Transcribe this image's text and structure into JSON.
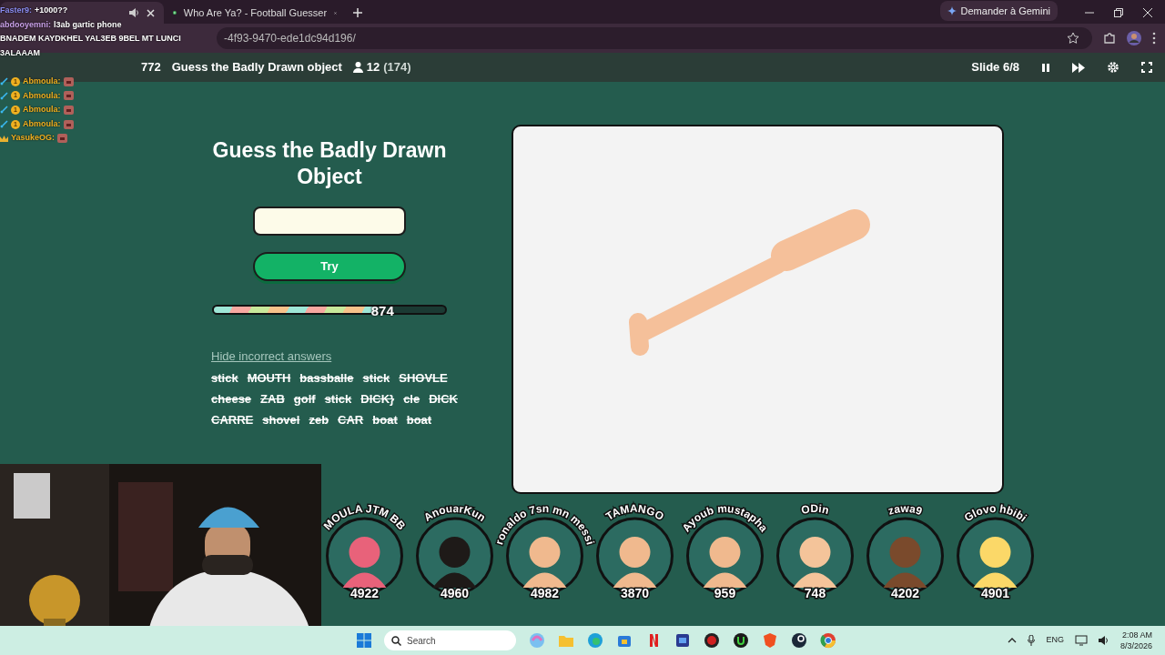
{
  "chat": [
    {
      "user": "Faster9:",
      "text": "+1000??"
    },
    {
      "user": "abdooyemni:",
      "text": "l3ab gartic phone"
    },
    {
      "text": "BNADEM KAYDKHEL YAL3EB 9BEL MT LUNCI"
    },
    {
      "text": "3ALAAAM"
    },
    {
      "badges": [
        {
          "kind": "sword"
        },
        {
          "kind": "coin",
          "label": "1"
        }
      ],
      "user": "Abmoula:",
      "emote": true
    },
    {
      "badges": [
        {
          "kind": "sword"
        },
        {
          "kind": "coin",
          "label": "1"
        }
      ],
      "user": "Abmoula:",
      "emote": true
    },
    {
      "badges": [
        {
          "kind": "sword"
        },
        {
          "kind": "coin",
          "label": "1"
        }
      ],
      "user": "Abmoula:",
      "emote": true
    },
    {
      "badges": [
        {
          "kind": "sword"
        },
        {
          "kind": "coin",
          "label": "1"
        }
      ],
      "user": "Abmoula:",
      "emote": true
    },
    {
      "badges": [
        {
          "kind": "crown"
        }
      ],
      "user": "YasukeOG:",
      "emote": true
    }
  ],
  "browser": {
    "tabs": [
      {
        "selected": true,
        "audio": true
      },
      {
        "title": "Who Are Ya? - Football Guesser",
        "selected": false,
        "audio": false
      }
    ],
    "gemini_button": "Demander à Gemini",
    "url": "-4f93-9470-ede1dc94d196/"
  },
  "quiz_header": {
    "pin": "772",
    "title": "Guess the Badly Drawn object",
    "players": "12",
    "total": "(174)",
    "slide": "Slide 6/8"
  },
  "question": {
    "title": "Guess the Badly Drawn Object",
    "button": "Try",
    "timer": {
      "level": 0.7,
      "reading": "874"
    },
    "toggle_link": "Hide incorrect answers",
    "incorrect_answers": [
      {
        "text": "stick",
        "crossed": true
      },
      {
        "text": "MOUTH",
        "crossed": true
      },
      {
        "text": "bassballe",
        "crossed": true
      },
      {
        "text": "stick",
        "crossed": true
      },
      {
        "text": "SHOVLE",
        "crossed": true
      },
      {
        "text": "cheese",
        "crossed": true
      },
      {
        "text": "ZAB",
        "crossed": true
      },
      {
        "text": "golf",
        "crossed": true
      },
      {
        "text": "stick",
        "crossed": true
      },
      {
        "text": "DICK}",
        "crossed": true
      },
      {
        "text": "cle",
        "crossed": true
      },
      {
        "text": "DICK",
        "crossed": true
      },
      {
        "text": "CARRE",
        "crossed": true
      },
      {
        "text": "shovel",
        "crossed": true
      },
      {
        "text": "zeb",
        "crossed": true
      },
      {
        "text": "CAR",
        "crossed": true
      },
      {
        "text": "boat",
        "crossed": true
      },
      {
        "text": "boat",
        "crossed": true
      }
    ]
  },
  "players": [
    {
      "name": "MOULA JTM BB",
      "score": "4922",
      "color": "#e8627a"
    },
    {
      "name": "AnouarKun",
      "score": "4960",
      "color": "#1e1a18"
    },
    {
      "name": "ronaldo 7sn mn messi",
      "score": "4982",
      "color": "#f0b98e"
    },
    {
      "name": "TAMANGO",
      "score": "3870",
      "color": "#f0b98e"
    },
    {
      "name": "Ayoub mustapha",
      "score": "959",
      "color": "#f0b98e"
    },
    {
      "name": "ODin",
      "score": "748",
      "color": "#f4c49a"
    },
    {
      "name": "zawa9",
      "score": "4202",
      "color": "#7a4a2c"
    },
    {
      "name": "Glovo hbibi",
      "score": "4901",
      "color": "#fbd868"
    }
  ],
  "taskbar": {
    "search_placeholder": "Search",
    "language": "ENG",
    "time": "2:08 AM",
    "date": "8/3/2026"
  }
}
